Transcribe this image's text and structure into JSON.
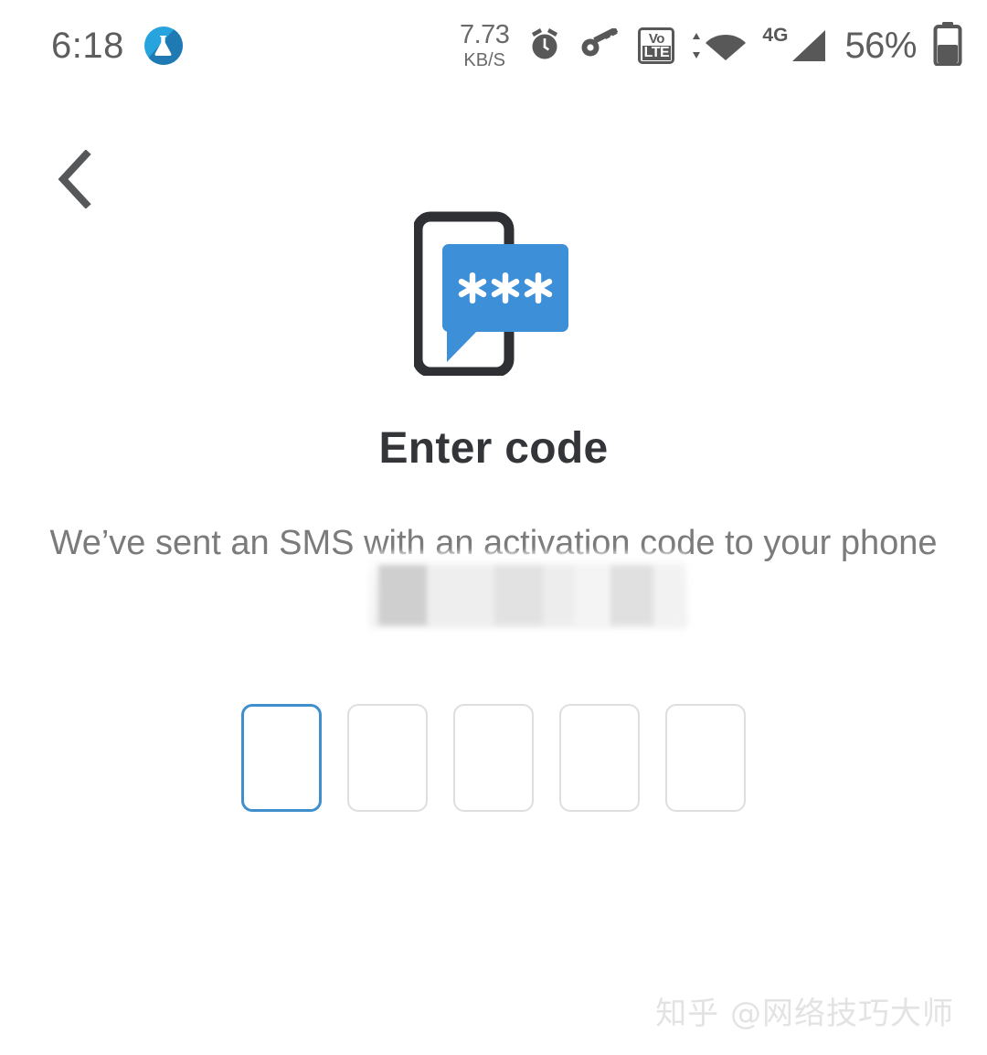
{
  "status_bar": {
    "clock": "6:18",
    "app_icon_name": "flask-app-icon",
    "network_speed_value": "7.73",
    "network_speed_unit": "KB/S",
    "alarm_icon": "alarm-clock-icon",
    "vpn_icon": "key-icon",
    "volte_top": "Vo",
    "volte_bottom": "LTE",
    "wifi_icon": "wifi-icon",
    "signal_label": "4G",
    "signal_icon": "cellular-signal-icon",
    "battery_percent": "56%",
    "battery_icon": "battery-icon"
  },
  "nav": {
    "back_label": "Back",
    "back_icon": "chevron-left-icon"
  },
  "illustration": {
    "name": "sms-code-illustration",
    "phone_color": "#2e3033",
    "bubble_color": "#3d8fd8",
    "asterisks": "✳ ✳ ✳"
  },
  "main": {
    "title": "Enter code",
    "description": "We’ve sent an SMS with an activation code to your phone",
    "phone_prefix": "+86",
    "phone_redacted": true
  },
  "code_input": {
    "length": 5,
    "focused_index": 0,
    "values": [
      "",
      "",
      "",
      "",
      ""
    ],
    "focus_color": "#3e8fcc",
    "idle_color": "#dedede"
  },
  "watermark": {
    "text": "知乎 @网络技巧大师"
  }
}
